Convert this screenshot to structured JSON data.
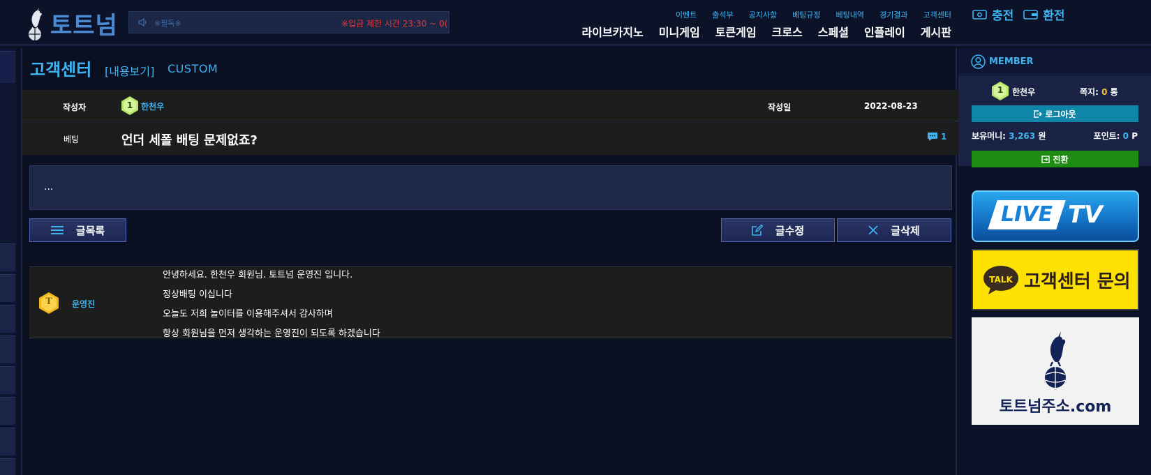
{
  "header": {
    "logo_text": "토트넘",
    "notice_mute": "※필독※",
    "notice_warning": "※입금 제한 시간 23:30 ~ 0(",
    "top_links": [
      "이벤트",
      "출석부",
      "공지사항",
      "베팅규정",
      "베팅내역",
      "경기결과",
      "고객센터"
    ],
    "main_menu": [
      "라이브카지노",
      "미니게임",
      "토큰게임",
      "크로스",
      "스페셜",
      "인플레이",
      "게시판"
    ],
    "charge_label": "충전",
    "exchange_label": "환전"
  },
  "board": {
    "title": "고객센터",
    "view_label": "[내용보기]",
    "category_label": "CUSTOM",
    "author_label": "작성자",
    "author_level": "1",
    "author_name": "한천우",
    "date_label": "작성일",
    "date_value": "2022-08-23",
    "category_tag": "베팅",
    "subject": "언더 세폴 배팅 문제없죠?",
    "comment_count": "1",
    "body": "...",
    "list_button": "글목록",
    "edit_button": "글수정",
    "delete_button": "글삭제"
  },
  "reply": {
    "badge_letter": "T",
    "author": "운영진",
    "lines": [
      "안녕하세요. 한천우 회원님. 토트넘 운영진 입니다.",
      "정상배팅 이십니다",
      "오늘도 저희 놀이터를 이용해주셔서 감사하며",
      "항상 회원님을 먼저 생각하는 운영진이 되도록 하겠습니다"
    ]
  },
  "sidebar": {
    "member_header": "MEMBER",
    "level": "1",
    "name": "한천우",
    "message_label": "쪽지:",
    "message_count": "0",
    "message_unit": "통",
    "logout_button": "로그아웃",
    "money_label": "보유머니:",
    "money_value": "3,263",
    "money_unit": "원",
    "point_label": "포인트:",
    "point_value": "0",
    "point_unit": "P",
    "convert_button": "전환",
    "banner_live_a": "LIVE",
    "banner_live_b": "TV",
    "banner_talk_icon": "TALK",
    "banner_talk_text": "고객센터 문의",
    "banner_site_text": "토트넘주소.com"
  },
  "colors": {
    "accent": "#3fb4f0",
    "background": "#0b1024",
    "row_background": "#1d1d1d",
    "logout": "#0f85a8",
    "convert": "#1e8c12",
    "warning": "#e03a3a"
  }
}
